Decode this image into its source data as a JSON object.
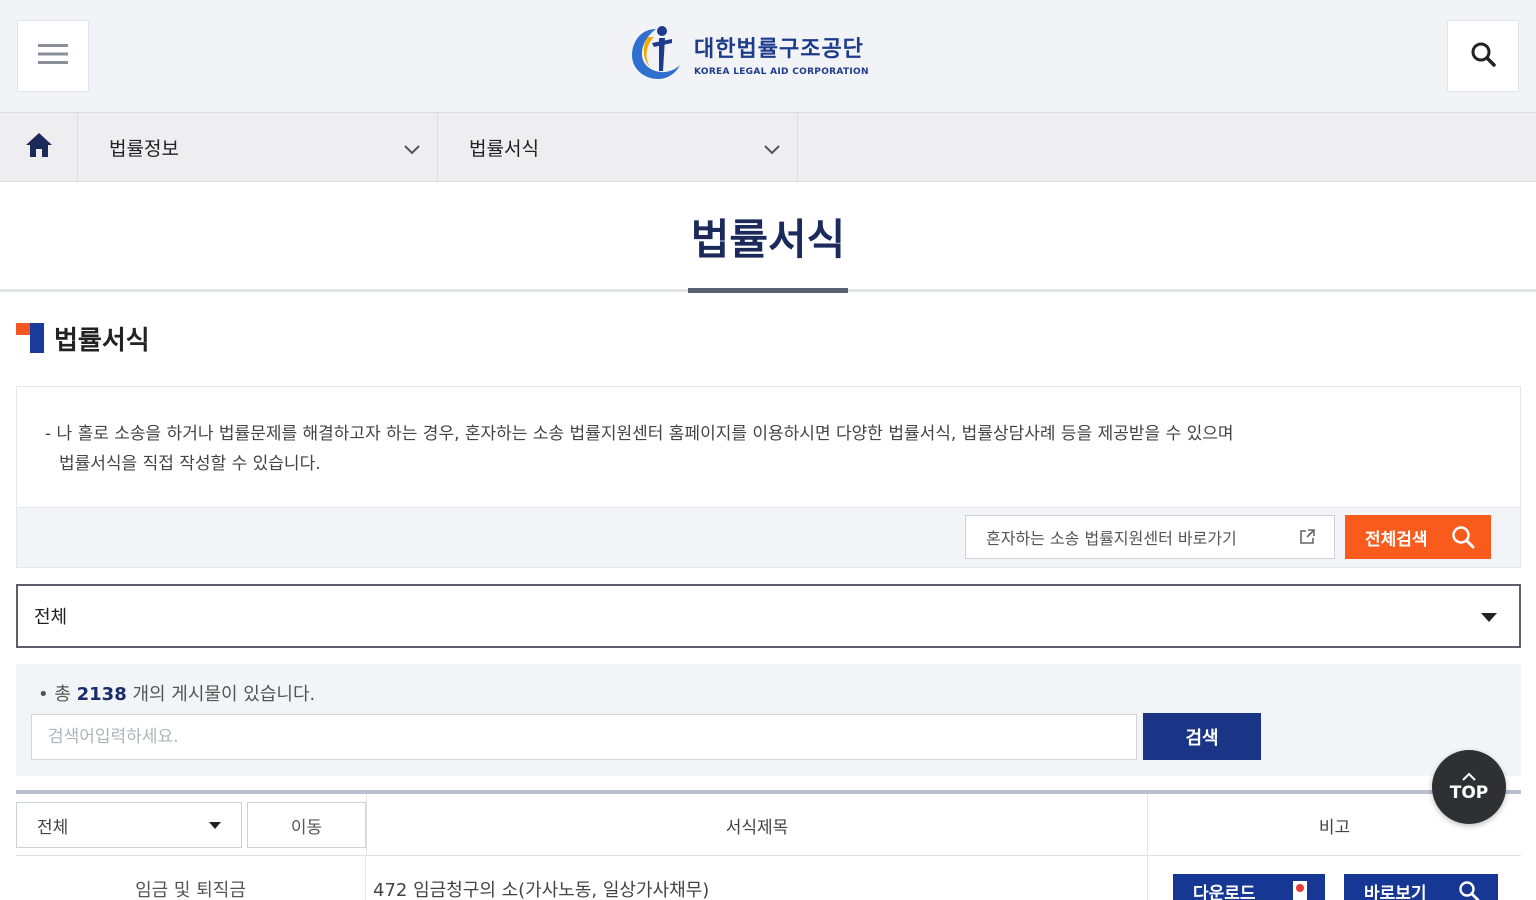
{
  "header": {
    "logo_ko": "대한법률구조공단",
    "logo_en": "KOREA LEGAL AID CORPORATION"
  },
  "nav": {
    "items": [
      {
        "label": "법률정보"
      },
      {
        "label": "법률서식"
      }
    ]
  },
  "page": {
    "title": "법률서식",
    "section_title": "법률서식"
  },
  "info": {
    "text_line1": "- 나 홀로 소송을 하거나 법률문제를 해결하고자 하는 경우, 혼자하는 소송 법률지원센터 홈페이지를 이용하시면 다양한 법률서식, 법률상담사례 등을 제공받을 수 있으며",
    "text_line2": "법률서식을 직접 작성할 수 있습니다.",
    "ext_link_label": "혼자하는 소송 법률지원센터 바로가기",
    "all_search_label": "전체검색"
  },
  "category_select": {
    "selected": "전체"
  },
  "search": {
    "count_prefix": "• 총 ",
    "count_value": "2138",
    "count_suffix": " 개의 게시물이 있습니다.",
    "placeholder": "검색어입력하세요.",
    "button_label": "검색"
  },
  "table": {
    "filter_selected": "전체",
    "move_label": "이동",
    "col_title": "서식제목",
    "col_note": "비고",
    "rows": [
      {
        "category": "임금 및 퇴직금",
        "title": "472 임금청구의 소(가사노동, 일상가사채무)",
        "download_label": "다운로드",
        "view_label": "바로보기"
      }
    ]
  },
  "top_button": {
    "label": "TOP"
  },
  "colors": {
    "brand_navy": "#1a3585",
    "accent_orange": "#f85b1b",
    "header_bg": "#f2f3f7"
  },
  "icons": [
    "menu-icon",
    "search-icon",
    "home-icon",
    "chevron-down-icon",
    "external-link-icon",
    "caret-down-icon",
    "file-icon",
    "magnifier-icon",
    "arrow-up-icon"
  ]
}
